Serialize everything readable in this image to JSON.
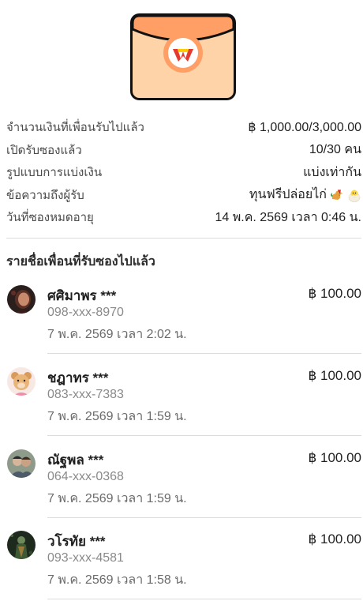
{
  "envelope": {
    "icon": "red-envelope-icon",
    "logo": "w-logo"
  },
  "summary": [
    {
      "label": "จำนวนเงินที่เพื่อนรับไปแล้ว",
      "value": "฿ 1,000.00/3,000.00"
    },
    {
      "label": "เปิดรับซองแล้ว",
      "value": "10/30 คน"
    },
    {
      "label": "รูปแบบการแบ่งเงิน",
      "value": "แบ่งเท่ากัน"
    },
    {
      "label": "ข้อความถึงผู้รับ",
      "value": "ทุนฟรีปล่อยไก่",
      "emojis": [
        "rooster-emoji",
        "hatching-chick-emoji"
      ]
    },
    {
      "label": "วันที่ซองหมดอายุ",
      "value": "14 พ.ค. 2569 เวลา 0:46 น."
    }
  ],
  "section_title": "รายชื่อเพื่อนที่รับซองไปแล้ว",
  "friends": [
    {
      "name": "ศศิมาพร ***",
      "amount": "฿ 100.00",
      "phone": "098-xxx-8970",
      "time": "7 พ.ค. 2569 เวลา 2:02 น."
    },
    {
      "name": "ชฎาทร ***",
      "amount": "฿ 100.00",
      "phone": "083-xxx-7383",
      "time": "7 พ.ค. 2569 เวลา 1:59 น."
    },
    {
      "name": "ณัฐพล ***",
      "amount": "฿ 100.00",
      "phone": "064-xxx-0368",
      "time": "7 พ.ค. 2569 เวลา 1:59 น."
    },
    {
      "name": "วโรทัย ***",
      "amount": "฿ 100.00",
      "phone": "093-xxx-4581",
      "time": "7 พ.ค. 2569 เวลา 1:58 น."
    }
  ]
}
